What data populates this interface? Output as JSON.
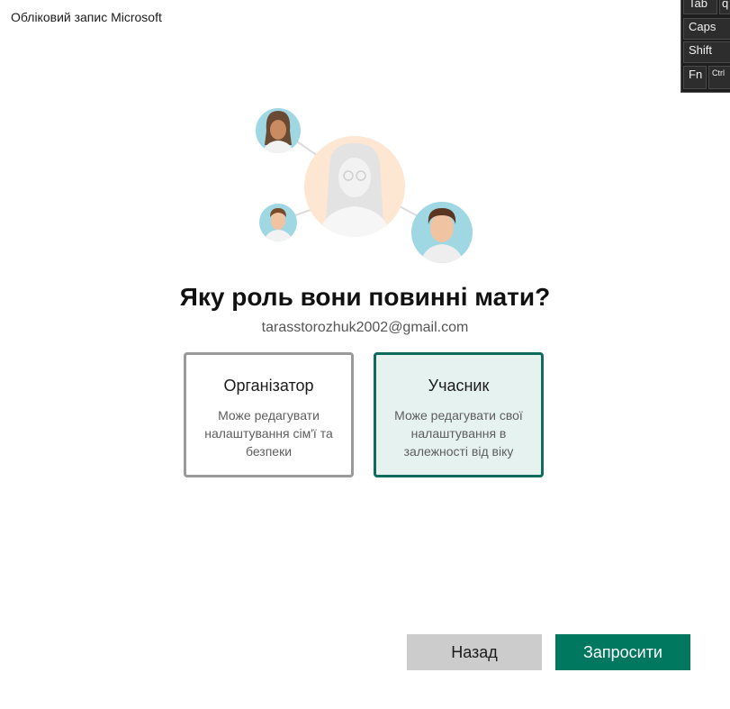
{
  "window": {
    "title": "Обліковий запис Microsoft"
  },
  "keyboard": {
    "keys": [
      "Tab",
      "q",
      "Caps",
      "Shift",
      "Fn",
      "Ctrl"
    ]
  },
  "main": {
    "question": "Яку роль вони повинні мати?",
    "email": "tarasstorozhuk2002@gmail.com",
    "roles": [
      {
        "title": "Організатор",
        "description": "Може редагувати налаштування сім'ї та безпеки",
        "selected": false
      },
      {
        "title": "Учасник",
        "description": "Може редагувати свої налаштування в залежності від віку",
        "selected": true
      }
    ]
  },
  "buttons": {
    "back": "Назад",
    "invite": "Запросити"
  },
  "colors": {
    "accent": "#00775f",
    "selected_border": "#0f6b5c",
    "selected_bg": "#e6f2ef",
    "secondary_button": "#cccccc"
  }
}
